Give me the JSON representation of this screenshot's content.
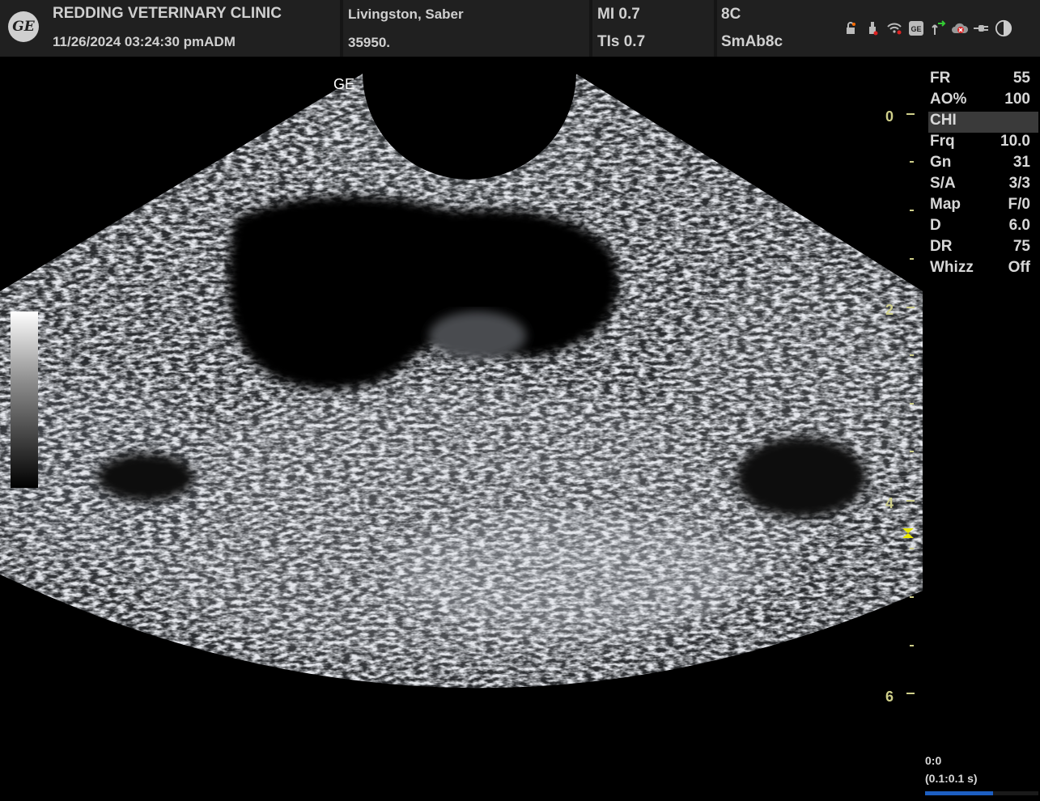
{
  "header": {
    "logo_text": "GE",
    "clinic": "REDDING VETERINARY CLINIC",
    "datetime": "11/26/2024 03:24:30 pmADM",
    "patient_name": "Livingston, Saber",
    "patient_id": "35950.",
    "mi": "MI 0.7",
    "tis": "TIs 0.7",
    "probe": "8C",
    "preset": "SmAb8c",
    "status_icons": [
      "lock-icon",
      "usb-icon",
      "wifi-icon",
      "ge-service-icon",
      "network-icon",
      "cloud-icon",
      "power-plug-icon",
      "contrast-icon"
    ]
  },
  "image": {
    "orientation_mark": "GE",
    "depth_labels": [
      "0",
      "2",
      "4",
      "6"
    ],
    "focus_depth": 4.35,
    "max_depth": 6
  },
  "params": [
    {
      "label": "FR",
      "value": "55"
    },
    {
      "label": "AO%",
      "value": "100"
    },
    {
      "label": "CHI",
      "value": "",
      "highlight": true
    },
    {
      "label": "Frq",
      "value": "10.0"
    },
    {
      "label": "Gn",
      "value": "31"
    },
    {
      "label": "S/A",
      "value": "3/3"
    },
    {
      "label": "Map",
      "value": "F/0"
    },
    {
      "label": "D",
      "value": "6.0"
    },
    {
      "label": "DR",
      "value": "75"
    },
    {
      "label": "Whizz",
      "value": "Off"
    }
  ],
  "cine": {
    "counter": "0:0",
    "timing": "(0.1:0.1 s)",
    "progress": 0.6
  },
  "colors": {
    "depth_scale": "#cfcf8a",
    "focus_marker": "#e8e800",
    "cine_progress": "#1d5fc2"
  }
}
